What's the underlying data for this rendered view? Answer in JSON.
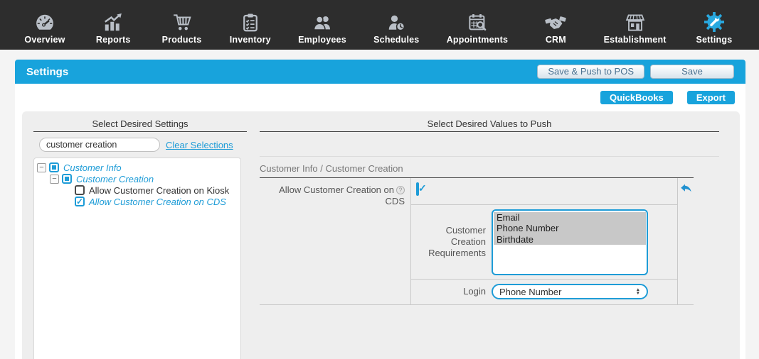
{
  "nav": {
    "items": [
      {
        "label": "Overview",
        "icon": "gauge-icon",
        "active": false
      },
      {
        "label": "Reports",
        "icon": "bar-chart-icon",
        "active": false
      },
      {
        "label": "Products",
        "icon": "cart-icon",
        "active": false
      },
      {
        "label": "Inventory",
        "icon": "clipboard-icon",
        "active": false
      },
      {
        "label": "Employees",
        "icon": "people-icon",
        "active": false
      },
      {
        "label": "Schedules",
        "icon": "person-clock-icon",
        "active": false
      },
      {
        "label": "Appointments",
        "icon": "calendar-search-icon",
        "active": false
      },
      {
        "label": "CRM",
        "icon": "handshake-icon",
        "active": false
      },
      {
        "label": "Establishment",
        "icon": "storefront-icon",
        "active": false
      },
      {
        "label": "Settings",
        "icon": "gear-wrench-icon",
        "active": true
      }
    ]
  },
  "header": {
    "title": "Settings",
    "save_push_label": "Save & Push to POS",
    "save_label": "Save"
  },
  "toolbar": {
    "quickbooks_label": "QuickBooks",
    "export_label": "Export"
  },
  "left_panel": {
    "heading": "Select Desired Settings",
    "search_value": "customer creation",
    "clear_link": "Clear Selections",
    "tree": [
      {
        "label": "Customer Info",
        "state": "indeterminate",
        "expanded": true,
        "depth": 0,
        "style": "active"
      },
      {
        "label": "Customer Creation",
        "state": "indeterminate",
        "expanded": true,
        "depth": 1,
        "style": "active"
      },
      {
        "label": "Allow Customer Creation on Kiosk",
        "state": "unchecked",
        "depth": 2,
        "style": "plain"
      },
      {
        "label": "Allow Customer Creation on CDS",
        "state": "checked",
        "depth": 2,
        "style": "active"
      }
    ]
  },
  "right_panel": {
    "heading": "Select Desired Values to Push",
    "section_title": "Customer Info / Customer Creation",
    "setting_label_line1": "Allow Customer Creation on",
    "setting_label_line2": "CDS",
    "help_icon": "?",
    "checkbox_checked": true,
    "requirements_label_lines": [
      "Customer",
      "Creation",
      "Requirements"
    ],
    "requirements_label": "Customer Creation Requirements",
    "requirements_options": [
      "Email",
      "Phone Number",
      "Birthdate"
    ],
    "requirements_selected": [
      "Email",
      "Phone Number",
      "Birthdate"
    ],
    "login_label": "Login",
    "login_value": "Phone Number"
  },
  "colors": {
    "accent_blue": "#18a3dc",
    "link_blue": "#1e9cd7",
    "nav_bg": "#2d2d2d",
    "panel_gray": "#eeeeee",
    "selected_option_gray": "#c8c8c8"
  }
}
